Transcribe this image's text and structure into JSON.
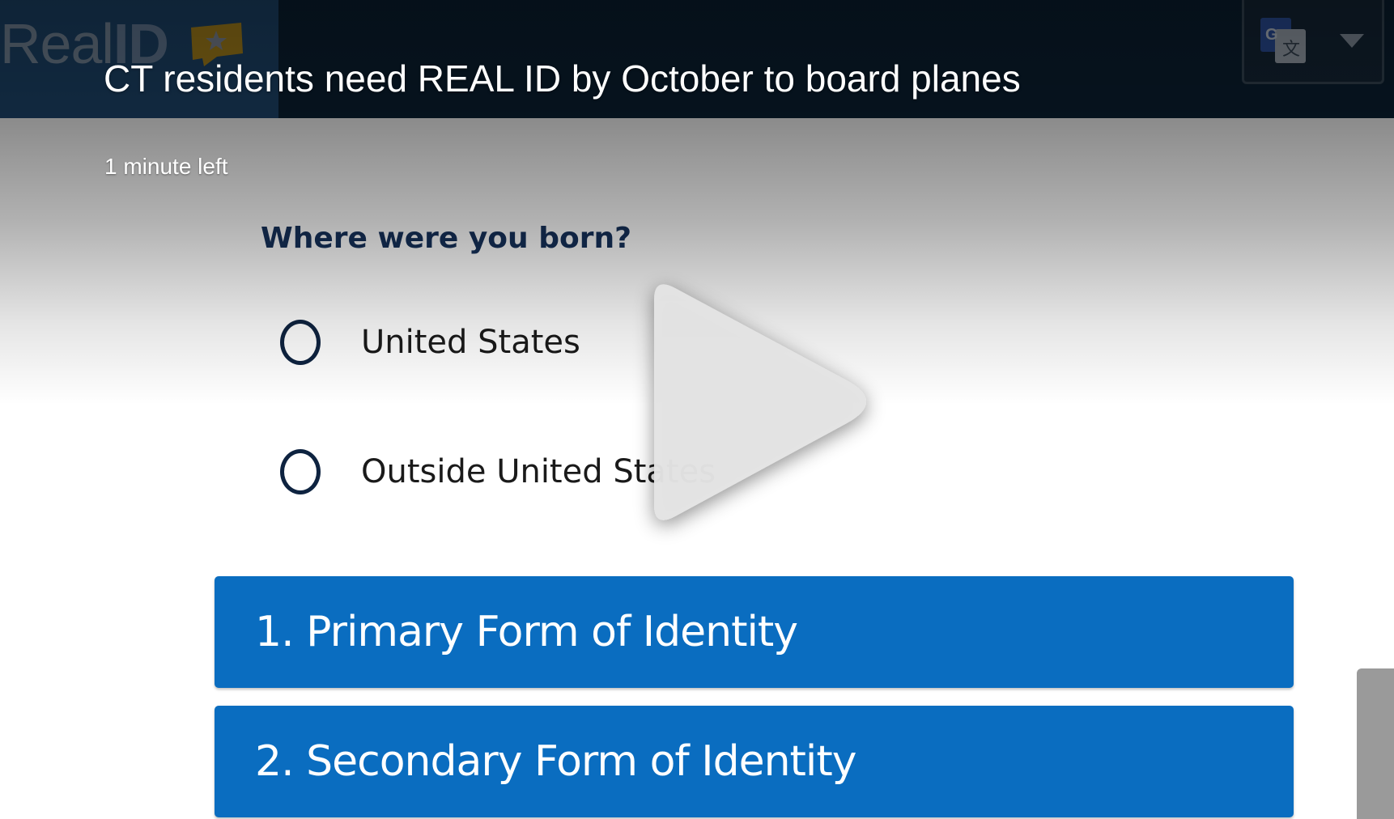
{
  "video": {
    "title": "CT residents need REAL ID by October to board planes",
    "time_left": "1 minute left",
    "play_icon": "play-icon"
  },
  "frame": {
    "site_logo": {
      "text_light": "Real",
      "text_bold": "ID",
      "icon": "connecticut-state-star-icon"
    },
    "translate_widget": {
      "icon": "google-translate-icon",
      "caret": "chevron-down-icon"
    },
    "question": "Where were you born?",
    "options": [
      {
        "label": "United States",
        "selected": false
      },
      {
        "label": "Outside United States",
        "selected": false
      }
    ],
    "sections": [
      {
        "label": "1. Primary Form of Identity"
      },
      {
        "label": "2. Secondary Form of Identity"
      }
    ]
  },
  "colors": {
    "header_navy": "#0b2236",
    "section_blue": "#0a6dc0",
    "question_navy": "#16325c",
    "overlay_text": "#ffffff"
  }
}
